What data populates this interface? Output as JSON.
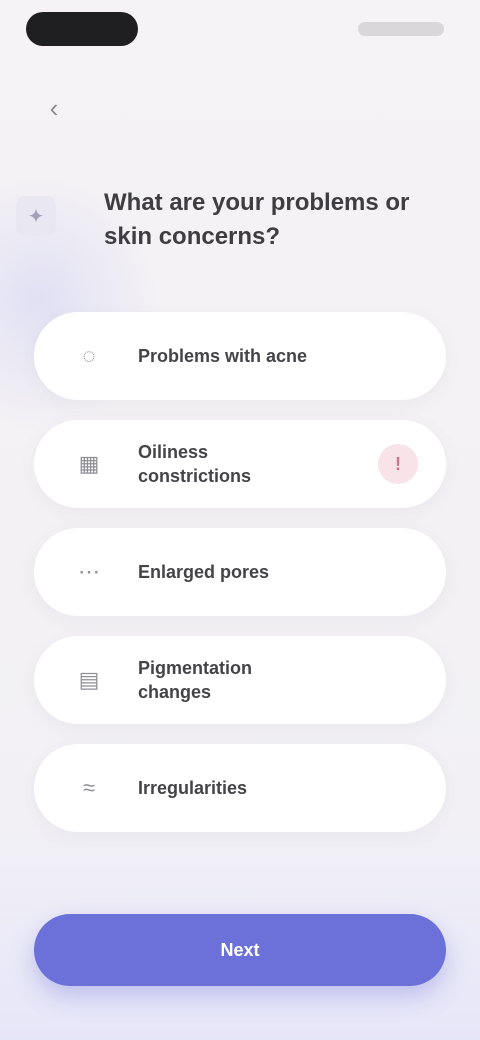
{
  "status_bar": {
    "time": "",
    "indicators": ""
  },
  "header": {
    "back_icon": "chevron-left-icon",
    "back_glyph": "‹",
    "header_icon": "sparkle-icon",
    "header_glyph": "✦",
    "title": "What are your problems or skin concerns?"
  },
  "options": [
    {
      "label": "Problems with acne",
      "icon": "drop-icon",
      "glyph": "◌",
      "badge": ""
    },
    {
      "label": "Oiliness\nconstrictions",
      "icon": "grid-icon",
      "glyph": "▦",
      "badge": "!"
    },
    {
      "label": "Enlarged pores",
      "icon": "circle-dots-icon",
      "glyph": "⋯",
      "badge": ""
    },
    {
      "label": "Pigmentation\nchanges",
      "icon": "layers-icon",
      "glyph": "▤",
      "badge": ""
    },
    {
      "label": "Irregularities",
      "icon": "wave-icon",
      "glyph": "≈",
      "badge": ""
    }
  ],
  "primary_button": {
    "label": "Next"
  },
  "colors": {
    "accent": "#6b71d9",
    "background": "#f4f2f4",
    "card": "#ffffff",
    "badge_bg": "#f7e3e8",
    "badge_fg": "#d4738a"
  }
}
